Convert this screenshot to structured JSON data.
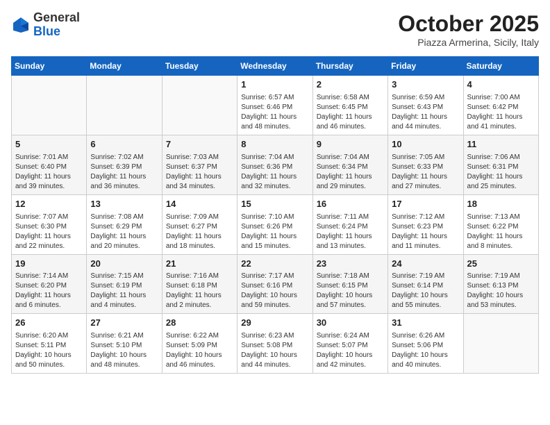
{
  "header": {
    "logo_general": "General",
    "logo_blue": "Blue",
    "month": "October 2025",
    "location": "Piazza Armerina, Sicily, Italy"
  },
  "weekdays": [
    "Sunday",
    "Monday",
    "Tuesday",
    "Wednesday",
    "Thursday",
    "Friday",
    "Saturday"
  ],
  "weeks": [
    [
      {
        "day": "",
        "info": ""
      },
      {
        "day": "",
        "info": ""
      },
      {
        "day": "",
        "info": ""
      },
      {
        "day": "1",
        "info": "Sunrise: 6:57 AM\nSunset: 6:46 PM\nDaylight: 11 hours and 48 minutes."
      },
      {
        "day": "2",
        "info": "Sunrise: 6:58 AM\nSunset: 6:45 PM\nDaylight: 11 hours and 46 minutes."
      },
      {
        "day": "3",
        "info": "Sunrise: 6:59 AM\nSunset: 6:43 PM\nDaylight: 11 hours and 44 minutes."
      },
      {
        "day": "4",
        "info": "Sunrise: 7:00 AM\nSunset: 6:42 PM\nDaylight: 11 hours and 41 minutes."
      }
    ],
    [
      {
        "day": "5",
        "info": "Sunrise: 7:01 AM\nSunset: 6:40 PM\nDaylight: 11 hours and 39 minutes."
      },
      {
        "day": "6",
        "info": "Sunrise: 7:02 AM\nSunset: 6:39 PM\nDaylight: 11 hours and 36 minutes."
      },
      {
        "day": "7",
        "info": "Sunrise: 7:03 AM\nSunset: 6:37 PM\nDaylight: 11 hours and 34 minutes."
      },
      {
        "day": "8",
        "info": "Sunrise: 7:04 AM\nSunset: 6:36 PM\nDaylight: 11 hours and 32 minutes."
      },
      {
        "day": "9",
        "info": "Sunrise: 7:04 AM\nSunset: 6:34 PM\nDaylight: 11 hours and 29 minutes."
      },
      {
        "day": "10",
        "info": "Sunrise: 7:05 AM\nSunset: 6:33 PM\nDaylight: 11 hours and 27 minutes."
      },
      {
        "day": "11",
        "info": "Sunrise: 7:06 AM\nSunset: 6:31 PM\nDaylight: 11 hours and 25 minutes."
      }
    ],
    [
      {
        "day": "12",
        "info": "Sunrise: 7:07 AM\nSunset: 6:30 PM\nDaylight: 11 hours and 22 minutes."
      },
      {
        "day": "13",
        "info": "Sunrise: 7:08 AM\nSunset: 6:29 PM\nDaylight: 11 hours and 20 minutes."
      },
      {
        "day": "14",
        "info": "Sunrise: 7:09 AM\nSunset: 6:27 PM\nDaylight: 11 hours and 18 minutes."
      },
      {
        "day": "15",
        "info": "Sunrise: 7:10 AM\nSunset: 6:26 PM\nDaylight: 11 hours and 15 minutes."
      },
      {
        "day": "16",
        "info": "Sunrise: 7:11 AM\nSunset: 6:24 PM\nDaylight: 11 hours and 13 minutes."
      },
      {
        "day": "17",
        "info": "Sunrise: 7:12 AM\nSunset: 6:23 PM\nDaylight: 11 hours and 11 minutes."
      },
      {
        "day": "18",
        "info": "Sunrise: 7:13 AM\nSunset: 6:22 PM\nDaylight: 11 hours and 8 minutes."
      }
    ],
    [
      {
        "day": "19",
        "info": "Sunrise: 7:14 AM\nSunset: 6:20 PM\nDaylight: 11 hours and 6 minutes."
      },
      {
        "day": "20",
        "info": "Sunrise: 7:15 AM\nSunset: 6:19 PM\nDaylight: 11 hours and 4 minutes."
      },
      {
        "day": "21",
        "info": "Sunrise: 7:16 AM\nSunset: 6:18 PM\nDaylight: 11 hours and 2 minutes."
      },
      {
        "day": "22",
        "info": "Sunrise: 7:17 AM\nSunset: 6:16 PM\nDaylight: 10 hours and 59 minutes."
      },
      {
        "day": "23",
        "info": "Sunrise: 7:18 AM\nSunset: 6:15 PM\nDaylight: 10 hours and 57 minutes."
      },
      {
        "day": "24",
        "info": "Sunrise: 7:19 AM\nSunset: 6:14 PM\nDaylight: 10 hours and 55 minutes."
      },
      {
        "day": "25",
        "info": "Sunrise: 7:19 AM\nSunset: 6:13 PM\nDaylight: 10 hours and 53 minutes."
      }
    ],
    [
      {
        "day": "26",
        "info": "Sunrise: 6:20 AM\nSunset: 5:11 PM\nDaylight: 10 hours and 50 minutes."
      },
      {
        "day": "27",
        "info": "Sunrise: 6:21 AM\nSunset: 5:10 PM\nDaylight: 10 hours and 48 minutes."
      },
      {
        "day": "28",
        "info": "Sunrise: 6:22 AM\nSunset: 5:09 PM\nDaylight: 10 hours and 46 minutes."
      },
      {
        "day": "29",
        "info": "Sunrise: 6:23 AM\nSunset: 5:08 PM\nDaylight: 10 hours and 44 minutes."
      },
      {
        "day": "30",
        "info": "Sunrise: 6:24 AM\nSunset: 5:07 PM\nDaylight: 10 hours and 42 minutes."
      },
      {
        "day": "31",
        "info": "Sunrise: 6:26 AM\nSunset: 5:06 PM\nDaylight: 10 hours and 40 minutes."
      },
      {
        "day": "",
        "info": ""
      }
    ]
  ]
}
